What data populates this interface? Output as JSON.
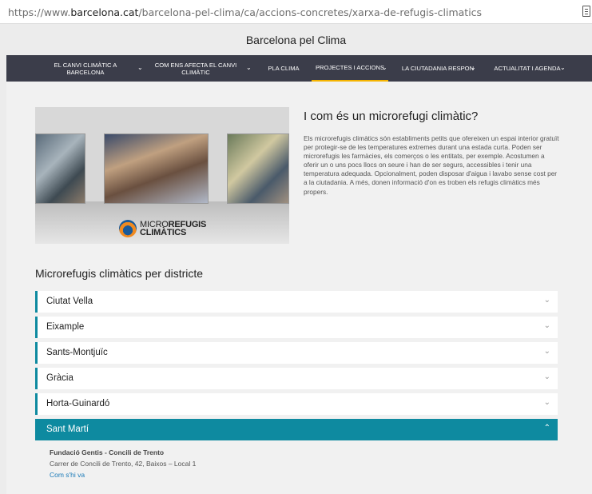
{
  "browser": {
    "url_prefix": "https://www.",
    "url_domain": "barcelona.cat",
    "url_path": "/barcelona-pel-clima/ca/accions-concretes/xarxa-de-refugis-climatics",
    "reader_icon": "reader-view-icon"
  },
  "site": {
    "title": "Barcelona pel Clima"
  },
  "nav": {
    "items": [
      {
        "label": "EL CANVI CLIMÀTIC A BARCELONA"
      },
      {
        "label": "COM ENS AFECTA EL CANVI CLIMÀTIC"
      },
      {
        "label": "PLA CLIMA"
      },
      {
        "label": "PROJECTES I ACCIONS"
      },
      {
        "label": "LA CIUTADANIA RESPON"
      },
      {
        "label": "ACTUALITAT I AGENDA"
      }
    ],
    "chevron": "⌄",
    "accent": "#f5b400"
  },
  "hero": {
    "logo_light": "MICRO",
    "logo_bold": "REFUGIS",
    "logo_line2": "CLIMÀTICS"
  },
  "intro": {
    "title": "I com és un microrefugi climàtic?",
    "text": "Els microrefugis climàtics són establiments petits que ofereixen un espai interior gratuït per protegir-se de les temperatures extremes durant una estada curta. Poden ser microrefugis les farmàcies, els comerços o les entitats, per exemple. Acostumen a oferir un o uns pocs llocs on seure i han de ser segurs, accessibles i tenir una temperatura adequada. Opcionalment, poden disposar d'aigua i lavabo sense cost per a la ciutadania. A més, donen informació d'on es troben els refugis climàtics més propers."
  },
  "districts": {
    "title": "Microrefugis climàtics per districte",
    "items": [
      {
        "label": "Ciutat Vella",
        "chevron": "⌄"
      },
      {
        "label": "Eixample",
        "chevron": "⌄"
      },
      {
        "label": "Sants-Montjuïc",
        "chevron": "⌄"
      },
      {
        "label": "Gràcia",
        "chevron": "⌄"
      },
      {
        "label": "Horta-Guinardó",
        "chevron": "⌄"
      },
      {
        "label": "Sant Martí",
        "chevron": "⌃"
      }
    ],
    "accent": "#0e8aa0",
    "open_detail": {
      "name": "Fundació Gentis - Concili de Trento",
      "address": "Carrer de Concili de Trento, 42, Baixos – Local 1",
      "link": "Com s'hi va"
    }
  }
}
